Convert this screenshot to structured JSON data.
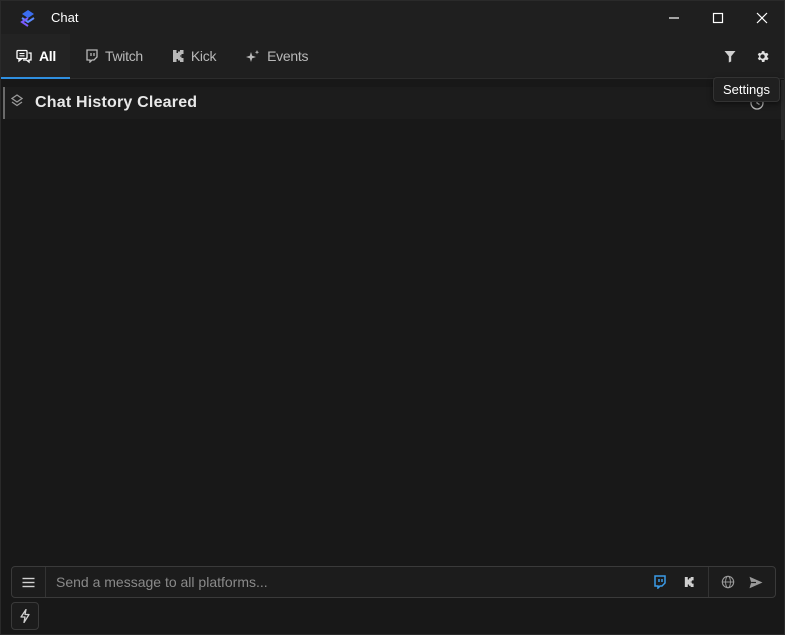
{
  "window": {
    "title": "Chat"
  },
  "tabs": [
    {
      "label": "All",
      "icon": "chat-bubbles-icon",
      "active": true
    },
    {
      "label": "Twitch",
      "icon": "twitch-icon",
      "active": false
    },
    {
      "label": "Kick",
      "icon": "kick-icon",
      "active": false
    },
    {
      "label": "Events",
      "icon": "sparkles-icon",
      "active": false
    }
  ],
  "tab_actions": {
    "filter_icon": "filter-icon",
    "settings_icon": "gear-icon"
  },
  "tooltip": {
    "text": "Settings"
  },
  "messages": {
    "system_text": "Chat History Cleared"
  },
  "composer": {
    "placeholder": "Send a message to all platforms...",
    "value": ""
  },
  "colors": {
    "accent": "#2f8fe0",
    "twitch": "#3b9be8",
    "kick": "#cfcfcf",
    "background": "#181818",
    "titlebar": "#1f1f1f"
  }
}
